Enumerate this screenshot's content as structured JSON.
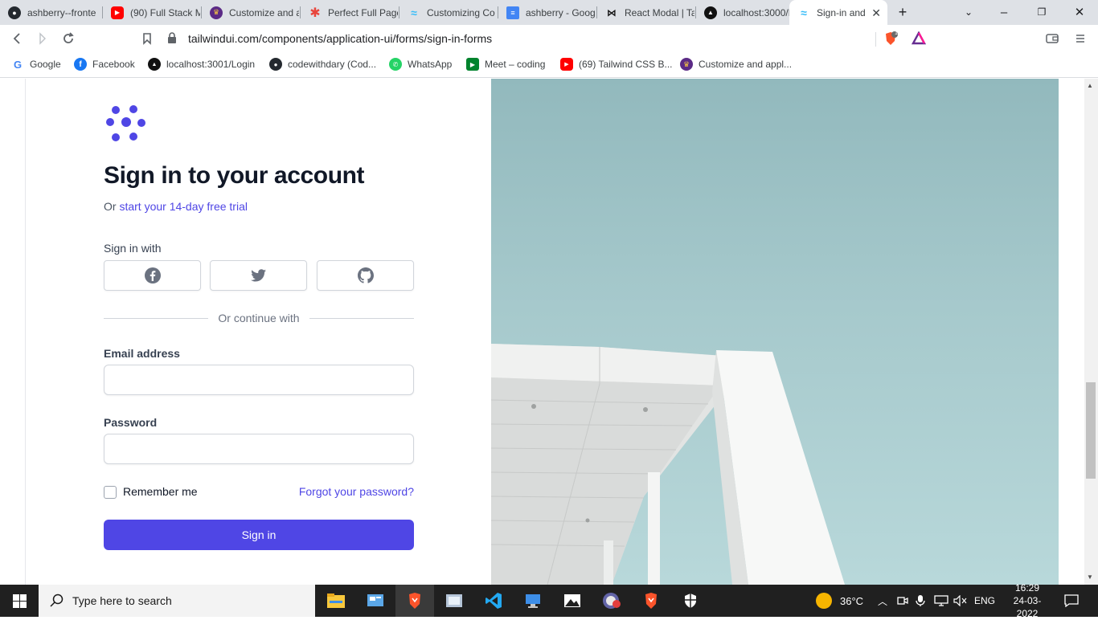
{
  "browser": {
    "tabs": [
      {
        "title": "ashberry--fronte",
        "icon": "github-icon"
      },
      {
        "title": "(90) Full Stack M",
        "icon": "youtube-icon"
      },
      {
        "title": "Customize and a",
        "icon": "crown-icon"
      },
      {
        "title": "Perfect Full Page",
        "icon": "asterisk-icon"
      },
      {
        "title": "Customizing Co",
        "icon": "tailwind-icon"
      },
      {
        "title": "ashberry - Goog",
        "icon": "docs-icon"
      },
      {
        "title": "React Modal | Ta",
        "icon": "bowtie-icon"
      },
      {
        "title": "localhost:3000/L",
        "icon": "triangle-icon"
      },
      {
        "title": "Sign-in and",
        "icon": "tailwind-icon"
      }
    ],
    "url": "tailwindui.com/components/application-ui/forms/sign-in-forms",
    "brave_shield_count": "1",
    "bookmarks": [
      {
        "label": "Google",
        "icon": "google-icon"
      },
      {
        "label": "Facebook",
        "icon": "facebook-icon"
      },
      {
        "label": "localhost:3001/Login",
        "icon": "triangle-icon"
      },
      {
        "label": "codewithdary (Cod...",
        "icon": "github-icon"
      },
      {
        "label": "WhatsApp",
        "icon": "whatsapp-icon"
      },
      {
        "label": "Meet – coding",
        "icon": "meet-icon"
      },
      {
        "label": "(69) Tailwind CSS B...",
        "icon": "youtube-icon"
      },
      {
        "label": "Customize and appl...",
        "icon": "crown-icon"
      }
    ]
  },
  "page": {
    "heading": "Sign in to your account",
    "subtitle_prefix": "Or",
    "trial_link": "start your 14-day free trial",
    "sign_in_with": "Sign in with",
    "social_buttons": [
      "facebook-icon",
      "twitter-icon",
      "github-icon"
    ],
    "divider_text": "Or continue with",
    "email_label": "Email address",
    "email_value": "",
    "password_label": "Password",
    "password_value": "",
    "remember_me": "Remember me",
    "forgot_password": "Forgot your password?",
    "sign_in_button": "Sign in"
  },
  "taskbar": {
    "search_placeholder": "Type here to search",
    "weather": "36°C",
    "language": "ENG",
    "time": "16:29",
    "date": "24-03-2022"
  },
  "colors": {
    "accent": "#4f46e5",
    "sky": "#a6c9cc"
  }
}
